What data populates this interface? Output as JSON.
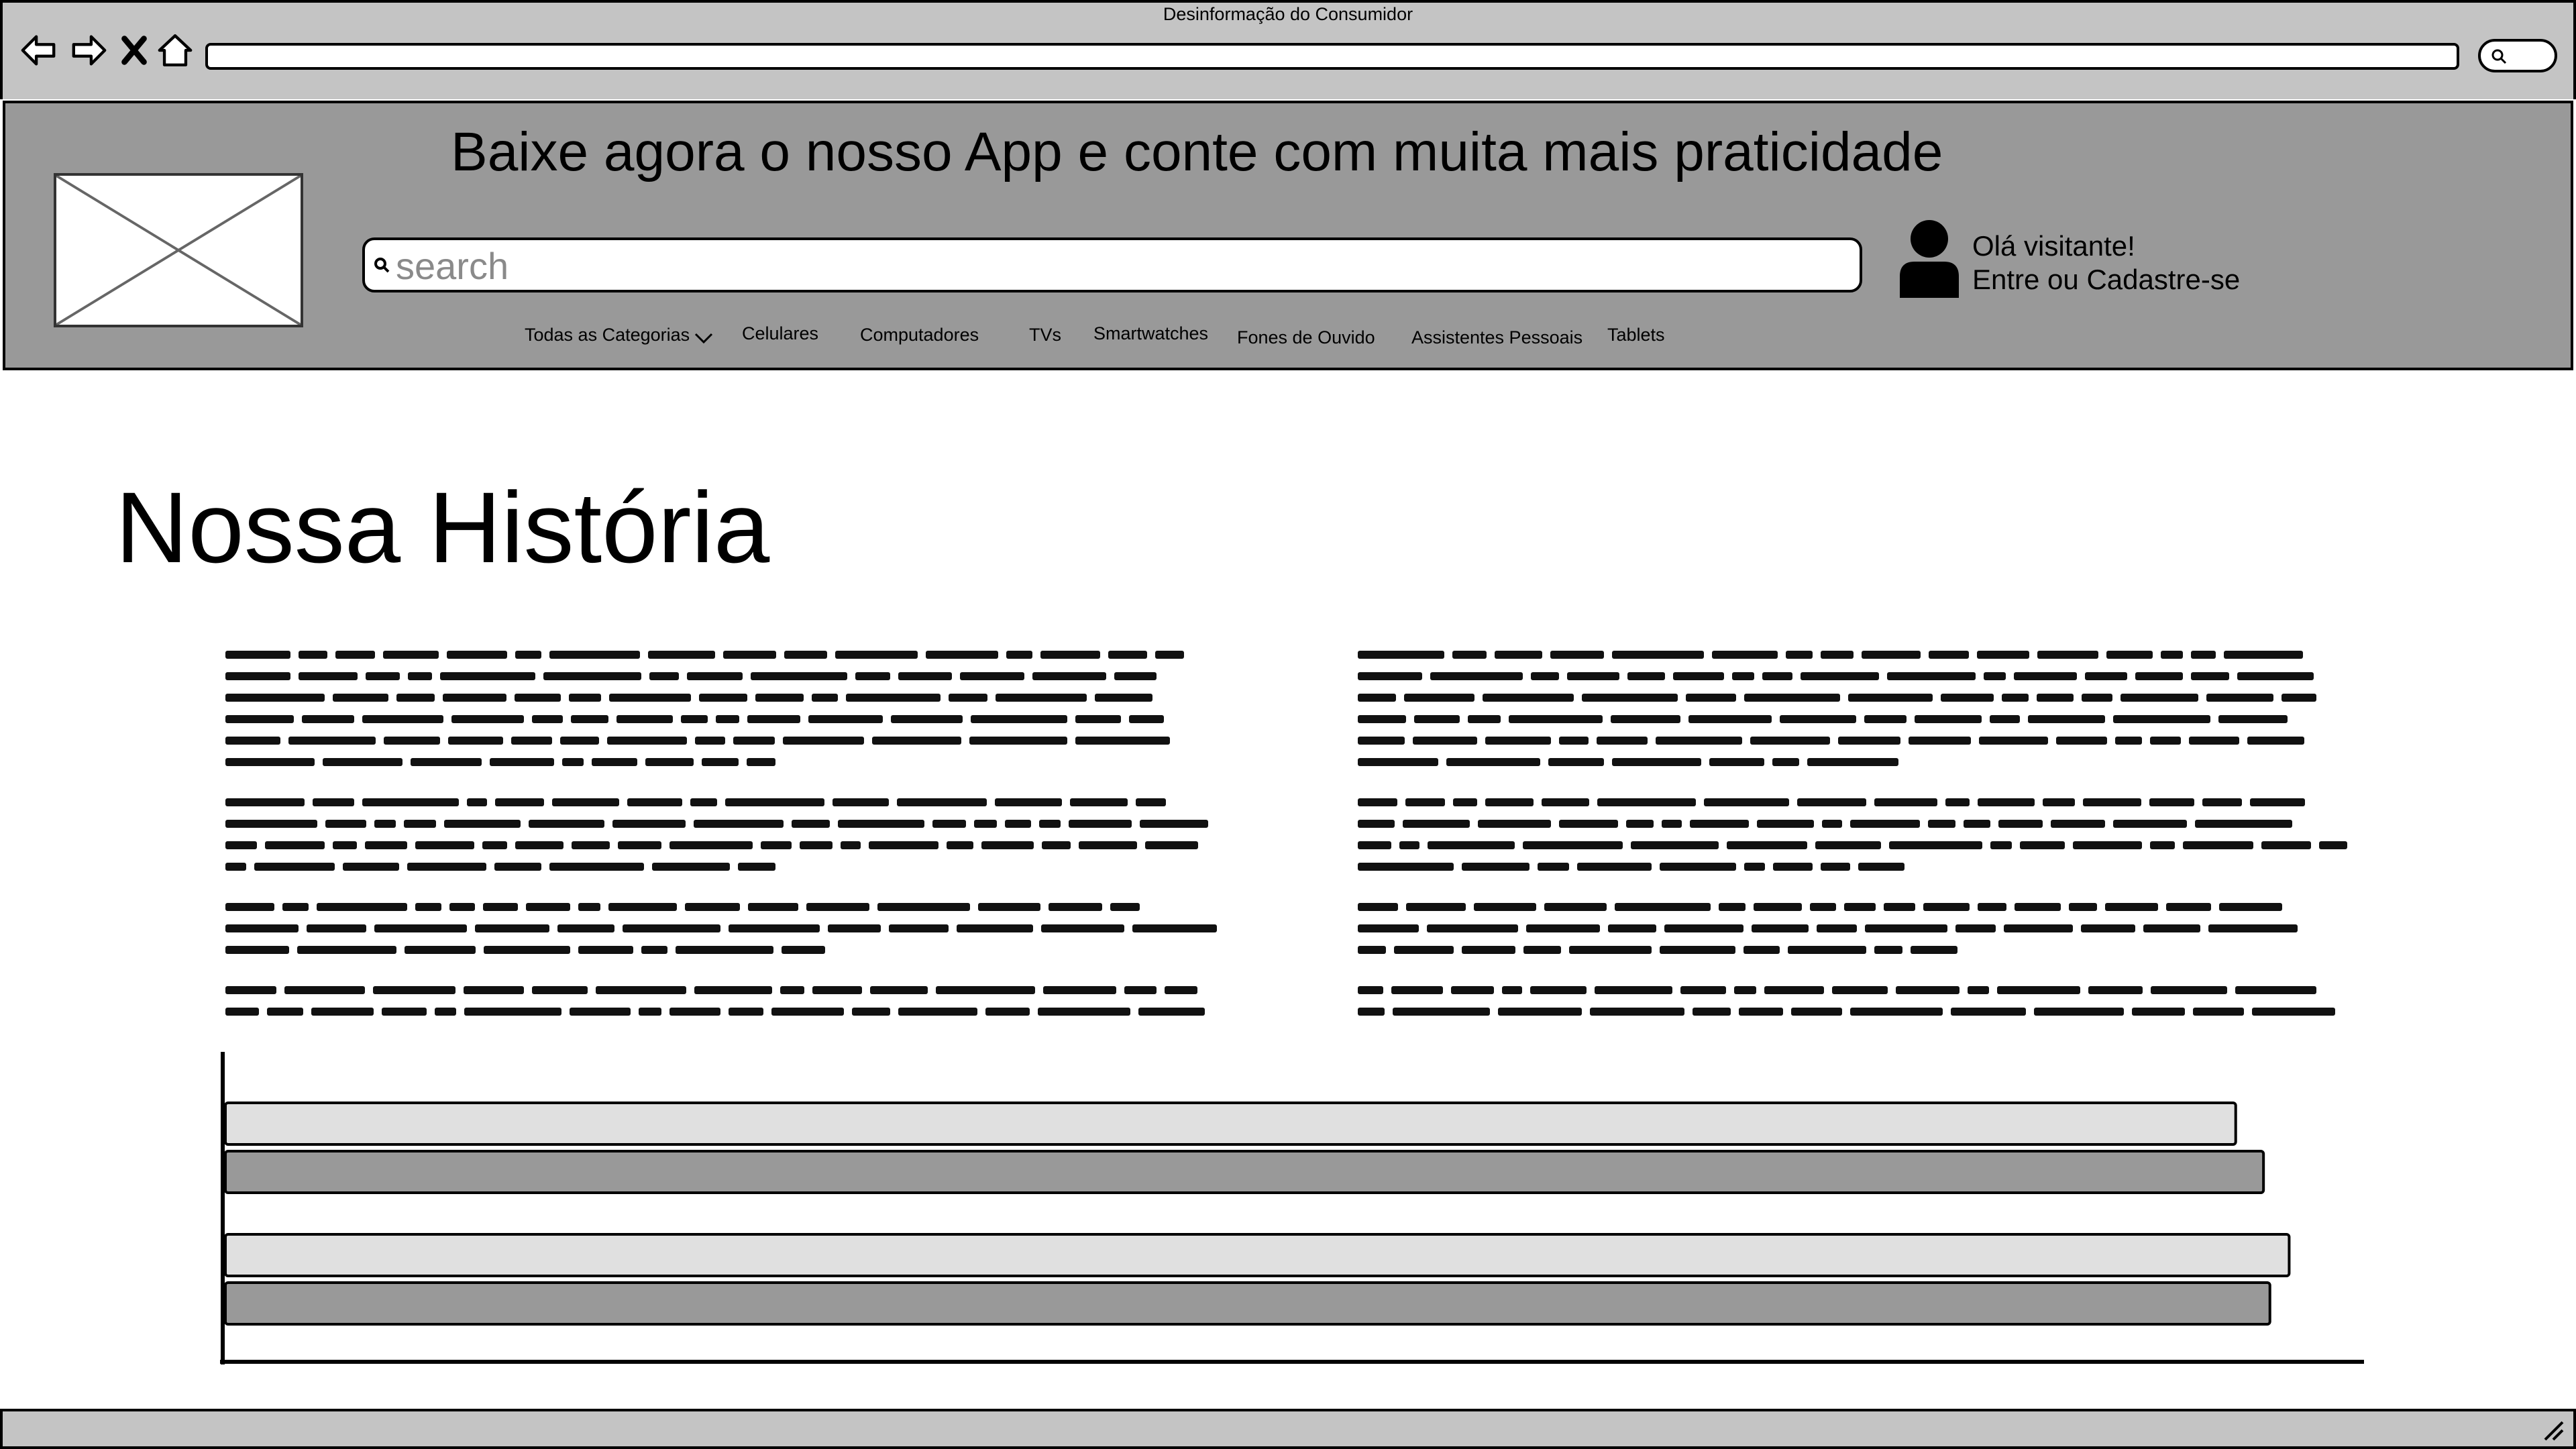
{
  "window": {
    "title": "Desinformação do Consumidor"
  },
  "browser": {
    "icons": [
      "back-arrow-icon",
      "forward-arrow-icon",
      "stop-icon",
      "home-icon",
      "search-icon"
    ]
  },
  "header": {
    "banner": "Baixe agora o nosso App e conte com muita mais praticidade",
    "search_placeholder": "search",
    "greeting_line1": "Olá visitante!",
    "greeting_line2": "Entre ou Cadastre-se",
    "nav": {
      "all_categories": "Todas as Categorias",
      "items": [
        "Celulares",
        "Computadores",
        "TVs",
        "Smartwatches",
        "Fones de Ouvido",
        "Assistentes Pessoais",
        "Tablets"
      ]
    }
  },
  "main": {
    "title": "Nossa História"
  },
  "chart_data": {
    "type": "bar",
    "orientation": "horizontal",
    "categories": [
      "",
      ""
    ],
    "series": [
      {
        "values": [
          0.94,
          0.965
        ]
      },
      {
        "values": [
          0.953,
          0.956
        ]
      }
    ],
    "xlim": [
      0,
      1
    ],
    "grid": false,
    "colors": [
      "#e0e0e0",
      "#999999"
    ]
  },
  "colors": {
    "chrome": "#c4c4c4",
    "header": "#999999",
    "bar_light": "#e0e0e0",
    "bar_dark": "#999999"
  }
}
